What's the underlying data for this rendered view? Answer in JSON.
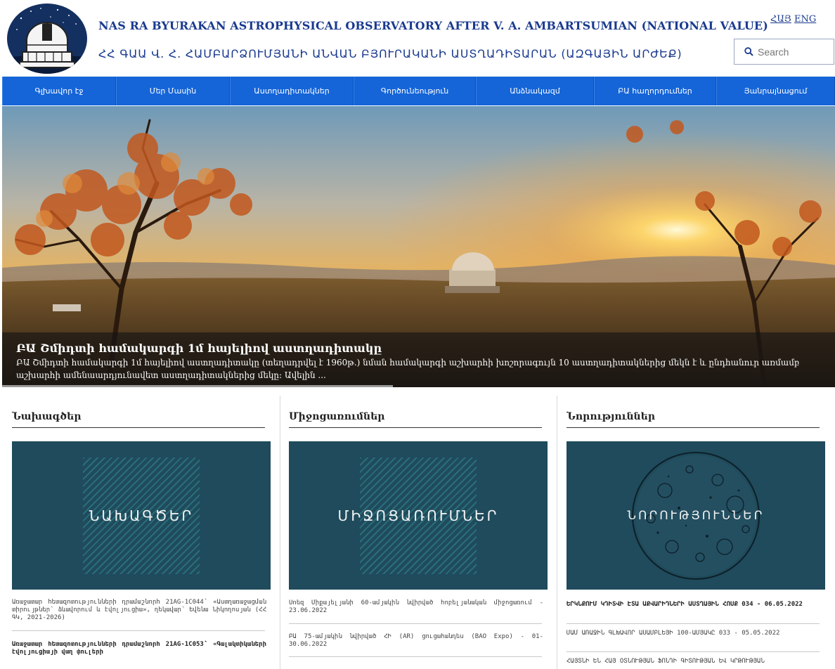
{
  "header": {
    "title_en": "NAS RA BYURAKAN ASTROPHYSICAL OBSERVATORY AFTER V. A. AMBARTSUMIAN (NATIONAL VALUE)",
    "title_hy": "ՀՀ ԳԱԱ Վ. Հ. ՀԱՄԲԱՐՁՈՒՄՅԱՆԻ ԱՆՎԱՆ ԲՅՈՒՐԱԿԱՆԻ ԱՍՏՂԱԴԻՏԱՐԱՆ (ԱԶԳԱՅԻՆ ԱՐԺԵՔ)",
    "lang_hy": "ՀԱՅ",
    "lang_en": "ENG",
    "search_placeholder": "Search"
  },
  "nav": {
    "items": [
      {
        "label": "Գլխավոր էջ"
      },
      {
        "label": "Մեր Մասին"
      },
      {
        "label": "Աստղադիտակներ"
      },
      {
        "label": "Գործունեություն"
      },
      {
        "label": "Անձնակազմ"
      },
      {
        "label": "ԲԱ հաղորդումներ"
      },
      {
        "label": "Յանրայնացում"
      }
    ]
  },
  "hero": {
    "caption_title": "ԲԱ Շմիդտի համակարգի 1մ հայելիով աստղադիտակը",
    "caption_text": "ԲԱ Շմիդտի համակարգի 1մ հայելիով աստղադիտակը (տեղադրվել է 1960թ.) նման համակարգի աշխարհի խոշորագույն 10 աստղադիտակներից մեկն է և ընդհանուր առմամբ աշխարհի ամենաարդյունավետ աստղադիտակներից մեկը: Ավելին ..."
  },
  "columns": {
    "projects": {
      "title": "Նախագծեր",
      "image_label": "ՆԱԽԱԳԾԵՐ",
      "item1": "Առաջատար հետազոտությունների դրամաշնորհ 21AG-1C044՝ «Աստղառաջացման տիրույթներ՝ ձևավորում և էվոլյուցիա», ղեկավար՝ Եվենա Նիկողոսյան (ՀՀ ԳԿ, 2021-2026)",
      "item2": "Առաջատար հետազոտությունների դրամաշնորհ 21AG-1C053՝ «Գալակտիկաների էվոլյուցիայի վաղ փուլերի"
    },
    "events": {
      "title": "Միջոցառումներ",
      "image_label": "ՄԻՋՈՑԱՌՈՒՄՆԵՐ",
      "item1": "Սոեզ Միքայելյանի 60-ամյակին նվիրված հոբելյանական միջոցառում - 23.06.2022",
      "item2": "ԲԱ 75-ամյակին նվիրված ՀԻ (AR) ցուցահանդես (BAO Expo) - 01-30.06.2022"
    },
    "news": {
      "title": "Նորություններ",
      "image_label": "ՆՈՐՈՒԹՅՈՒՆՆԵՐ",
      "item1": "ԵՐԿՆՔՈՒՄ ԿԴԻՏՎԻ ԷՏԱ ԱՔՎԱՐԻԴՆԵՐԻ ԱՍՏՂԱՅԻՆ ՀՈՍՔ 034 - 06.05.2022",
      "item2": "ՄԱՄ ԱՌԱՋԻՆ ԳԼԽԱՎՈՐ ԱՍԱՄԲԼԵՅԻ 100-ԱՄՅԱԿԸ 033 - 05.05.2022",
      "item3": "ՀԱՅՏՆԻ ԵՆ ՀԱՅ ՕՏՆՈՒԹՅԱՆ ՖՈՆԴԻ ԳԻՏՈՒԹՅԱՆ ԵՎ ԿՐԹՈՒԹՅԱՆ"
    }
  },
  "colors": {
    "brand_blue": "#1a3a8f",
    "nav_blue": "#1565d8",
    "card_teal": "#1f4b5c"
  }
}
